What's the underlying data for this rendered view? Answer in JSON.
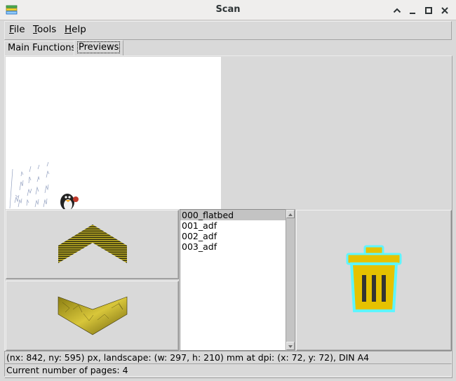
{
  "window": {
    "title": "Scan",
    "controls": [
      "minimize-icon",
      "maximize-icon",
      "restore-icon",
      "close-icon"
    ]
  },
  "menubar": {
    "items": [
      {
        "label": "File",
        "mnemonic": "F",
        "rest": "ile"
      },
      {
        "label": "Tools",
        "mnemonic": "T",
        "rest": "ools"
      },
      {
        "label": "Help",
        "mnemonic": "H",
        "rest": "elp"
      }
    ]
  },
  "tabs": [
    {
      "label": "Main Functions",
      "active": false
    },
    {
      "label": "Previews",
      "active": true
    }
  ],
  "previews": {
    "pages": [
      "000_flatbed",
      "001_adf",
      "002_adf",
      "003_adf"
    ],
    "selected_index": 0,
    "up_button_icon": "chevron-up-icon",
    "down_button_icon": "chevron-down-icon",
    "delete_button_icon": "trash-icon"
  },
  "status": {
    "dimensions": "(nx: 842, ny: 595) px, landscape: (w: 297, h: 210) mm at dpi: (x: 72, y: 72), DIN A4",
    "page_count": "Current number of pages: 4"
  },
  "colors": {
    "trash_fill": "#e6c200",
    "trash_outline": "#5ff5ff",
    "chevron": "#b2a420"
  }
}
